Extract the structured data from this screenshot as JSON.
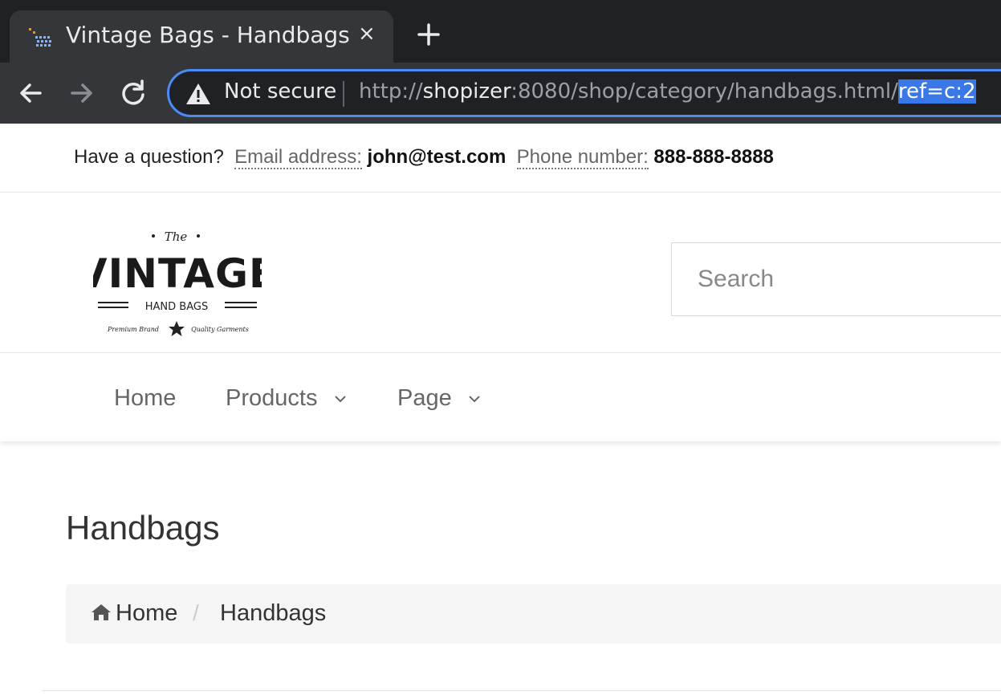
{
  "browser": {
    "tab": {
      "title": "Vintage Bags - Handbags",
      "close_glyph": "×",
      "favicon": "shop-favicon-icon"
    },
    "new_tab_icon": "plus-icon",
    "nav": {
      "back_icon": "back-arrow-icon",
      "forward_icon": "forward-arrow-icon",
      "reload_icon": "reload-icon"
    },
    "omnibox": {
      "security_label": "Not secure",
      "url_scheme": "http://",
      "url_host": "shopizer",
      "url_path": ":8080/shop/category/handbags.html/",
      "url_selected": "ref=c:2",
      "focus_color": "#4c8bf5",
      "selection_color": "#3b78e7"
    }
  },
  "topbar": {
    "question": "Have a question?",
    "email_label": "Email address:",
    "email": "john@test.com",
    "phone_label": "Phone number:",
    "phone": "888-888-8888"
  },
  "header": {
    "logo": {
      "top": "The",
      "main": "VINTAGE",
      "sub": "HAND BAGS",
      "left_tag": "Premium Brand",
      "right_tag": "Quality Garments"
    },
    "search_placeholder": "Search"
  },
  "menu": {
    "items": [
      {
        "label": "Home",
        "dropdown": false
      },
      {
        "label": "Products",
        "dropdown": true
      },
      {
        "label": "Page",
        "dropdown": true
      }
    ]
  },
  "category": {
    "title": "Handbags",
    "breadcrumb": {
      "home": "Home",
      "separator": "/",
      "current": "Handbags"
    }
  }
}
